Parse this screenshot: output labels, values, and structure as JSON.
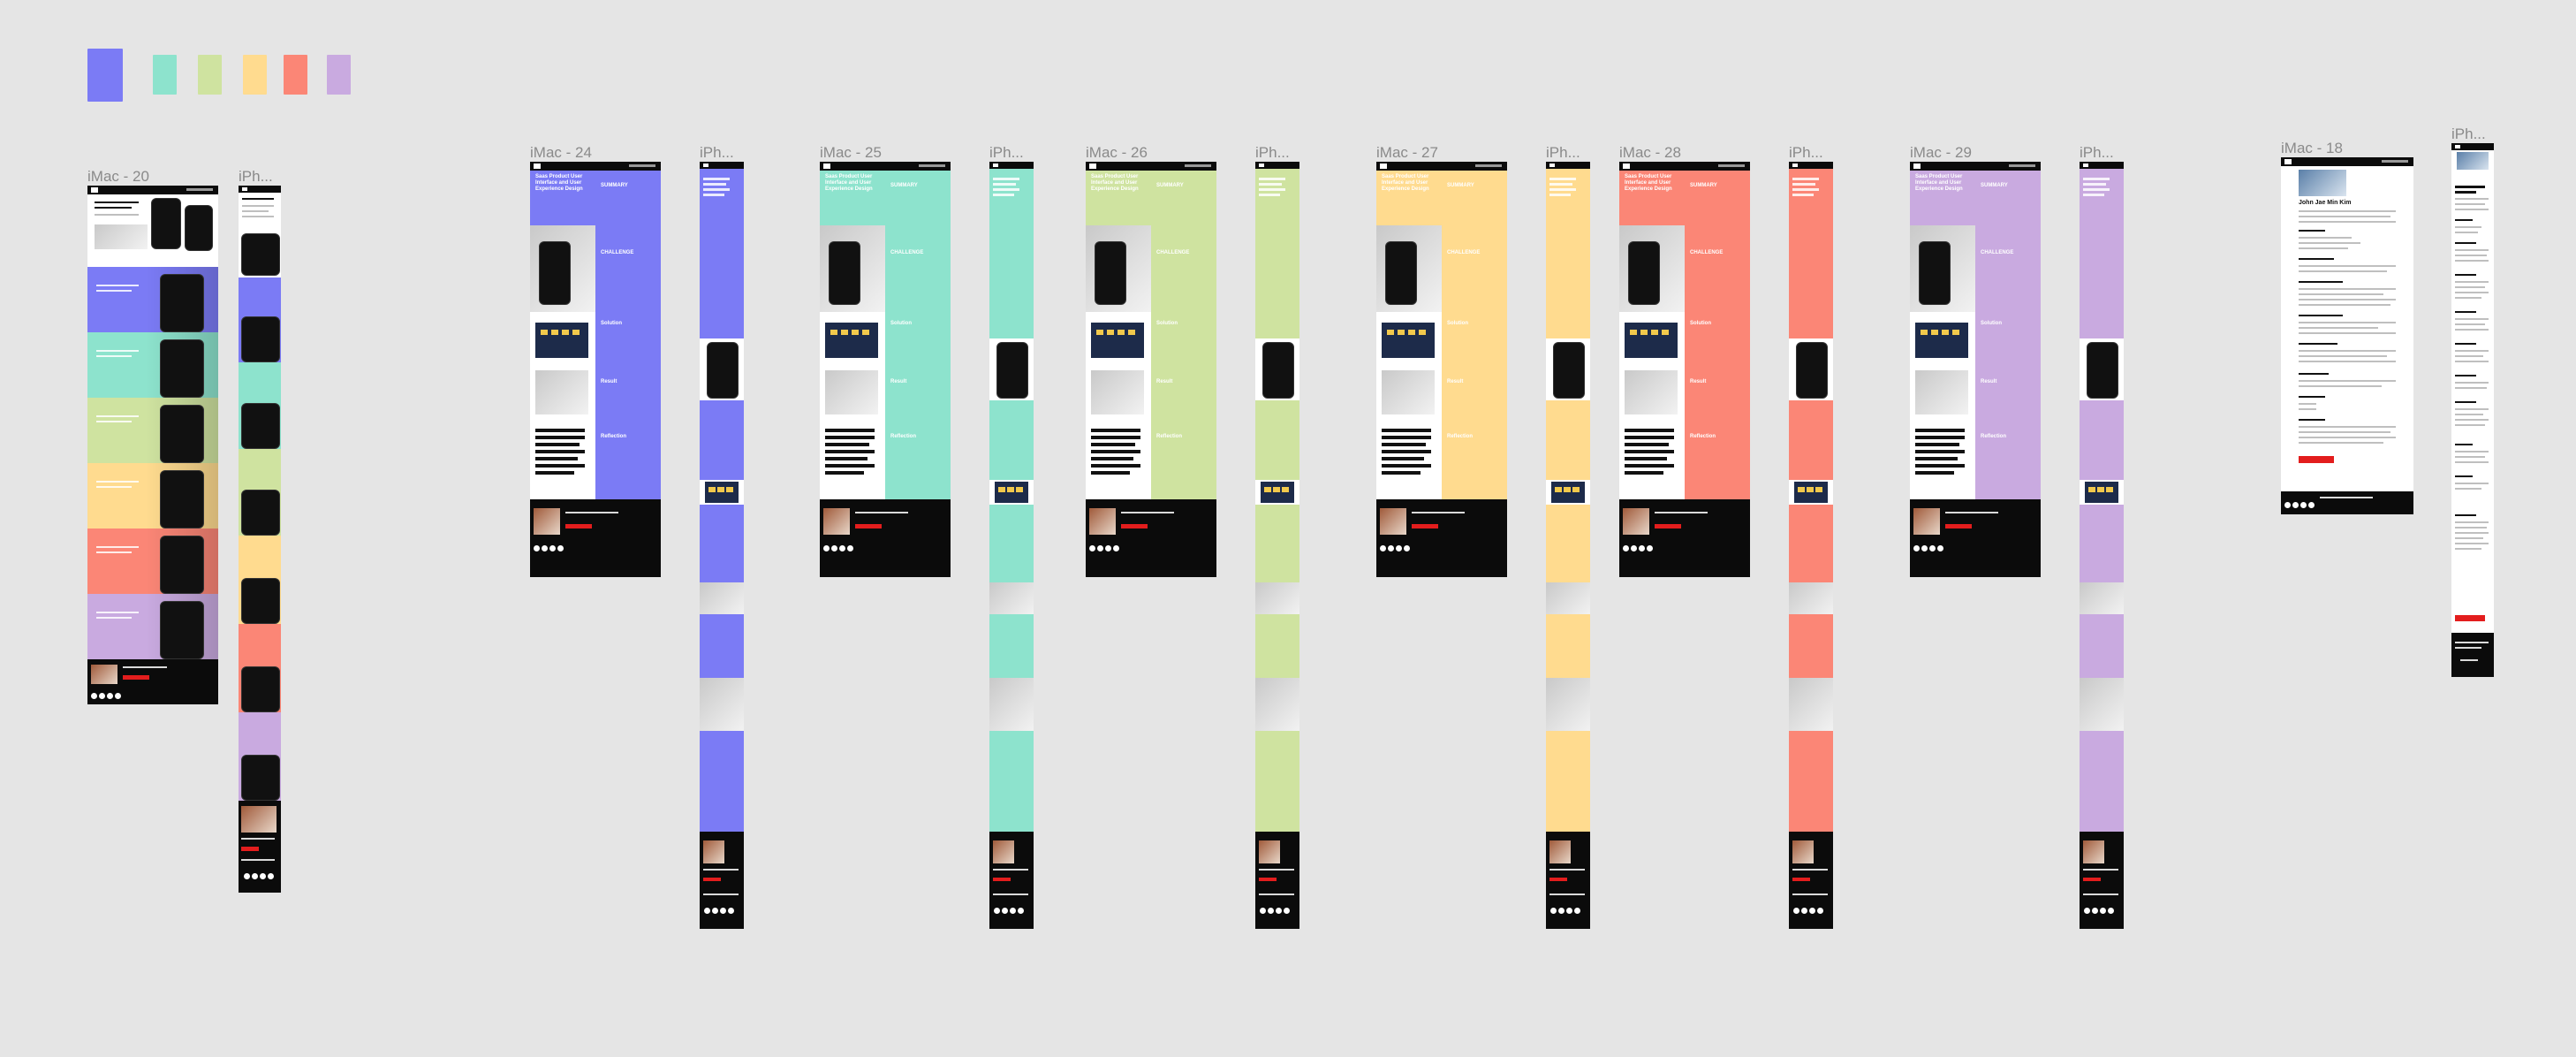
{
  "palette": {
    "swatches": [
      "#7b7bf5",
      "#8de3cd",
      "#cfe3a0",
      "#ffdb8f",
      "#fb8676",
      "#c9aae0"
    ]
  },
  "frames": {
    "imac20": {
      "label": "iMac - 20"
    },
    "iph20": {
      "label": "iPh..."
    },
    "imac24": {
      "label": "iMac - 24",
      "color": "#7b7bf5"
    },
    "iph24": {
      "label": "iPh..."
    },
    "imac25": {
      "label": "iMac - 25",
      "color": "#8de3cd"
    },
    "iph25": {
      "label": "iPh..."
    },
    "imac26": {
      "label": "iMac - 26",
      "color": "#cfe3a0"
    },
    "iph26": {
      "label": "iPh..."
    },
    "imac27": {
      "label": "iMac - 27",
      "color": "#ffdb8f"
    },
    "iph27": {
      "label": "iPh..."
    },
    "imac28": {
      "label": "iMac - 28",
      "color": "#fb8676"
    },
    "iph28": {
      "label": "iPh..."
    },
    "imac29": {
      "label": "iMac - 29",
      "color": "#c9aae0"
    },
    "iph29": {
      "label": "iPh..."
    },
    "imac18": {
      "label": "iMac - 18"
    },
    "iph18": {
      "label": "iPh..."
    }
  },
  "case_study": {
    "hero_title": "Saas Product User Interface and User Experience Design",
    "summary": "SUMMARY",
    "challenge": "CHALLENGE",
    "solution": "Solution",
    "result": "Result",
    "reflection": "Reflection"
  },
  "resume": {
    "name": "John Jae Min Kim"
  }
}
